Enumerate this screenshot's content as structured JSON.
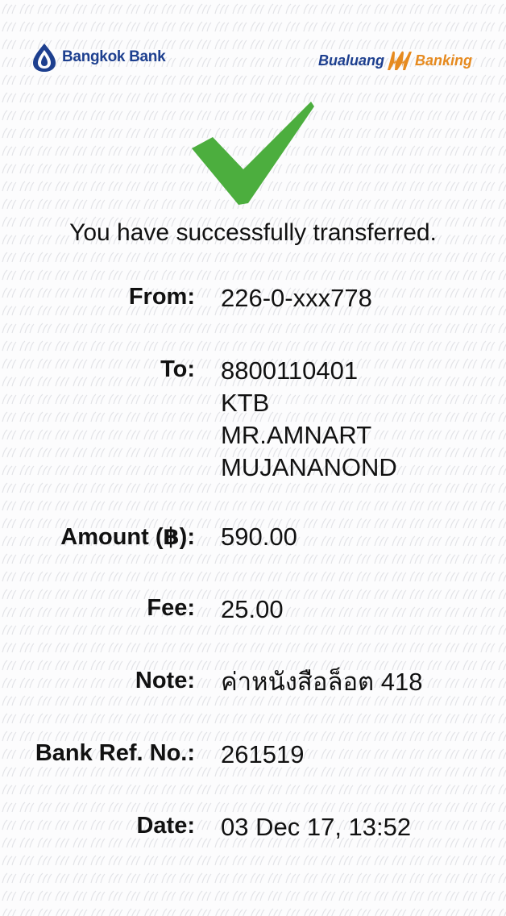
{
  "header": {
    "bank_name": "Bangkok Bank",
    "app_name_left": "Bualuang",
    "app_name_right": "Banking",
    "brand_blue": "#1d3f8f",
    "brand_orange": "#e68a1f"
  },
  "status": {
    "icon": "checkmark-icon",
    "icon_color": "#4cae3e",
    "message": "You have successfully transferred."
  },
  "transfer": {
    "from": {
      "label": "From:",
      "value": "226-0-xxx778"
    },
    "to": {
      "label": "To:",
      "account": "8800110401",
      "bank": "KTB",
      "name_line1": "MR.AMNART",
      "name_line2": "MUJANANOND"
    },
    "amount": {
      "label": "Amount (฿):",
      "value": "590.00"
    },
    "fee": {
      "label": "Fee:",
      "value": "25.00"
    },
    "note": {
      "label": "Note:",
      "value": "ค่าหนังสือล็อต 418"
    },
    "ref": {
      "label": "Bank Ref. No.:",
      "value": "261519"
    },
    "date": {
      "label": "Date:",
      "value": "03 Dec 17, 13:52"
    }
  }
}
